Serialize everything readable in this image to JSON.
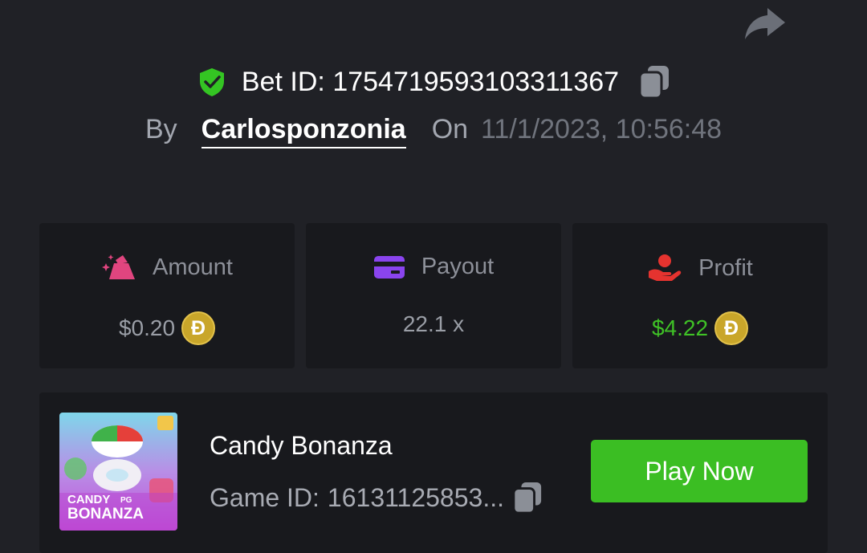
{
  "share": {
    "icon": "share-arrow-icon"
  },
  "bet": {
    "id_label": "Bet ID:",
    "id_value": "1754719593103311367",
    "verified_icon": "shield-check-icon",
    "copy_icon": "copy-icon"
  },
  "byline": {
    "by_label": "By",
    "username": "Carlosponzonia",
    "on_label": "On",
    "timestamp": "11/1/2023, 10:56:48"
  },
  "stats": {
    "amount": {
      "label": "Amount",
      "value": "$0.20",
      "icon": "gem-amount-icon",
      "currency_symbol": "Đ",
      "color": "#9a9ea6"
    },
    "payout": {
      "label": "Payout",
      "value": "22.1 x",
      "icon": "credit-card-icon",
      "color": "#9a9ea6"
    },
    "profit": {
      "label": "Profit",
      "value": "$4.22",
      "icon": "hand-coin-icon",
      "currency_symbol": "Đ",
      "color": "#3fc126"
    }
  },
  "game": {
    "name": "Candy Bonanza",
    "id_label": "Game ID:",
    "id_value": "16131125853...",
    "thumb_title_line1": "CANDY",
    "thumb_title_line2": "BONANZA",
    "thumb_badge": "PG",
    "play_label": "Play Now",
    "copy_icon": "copy-icon"
  }
}
